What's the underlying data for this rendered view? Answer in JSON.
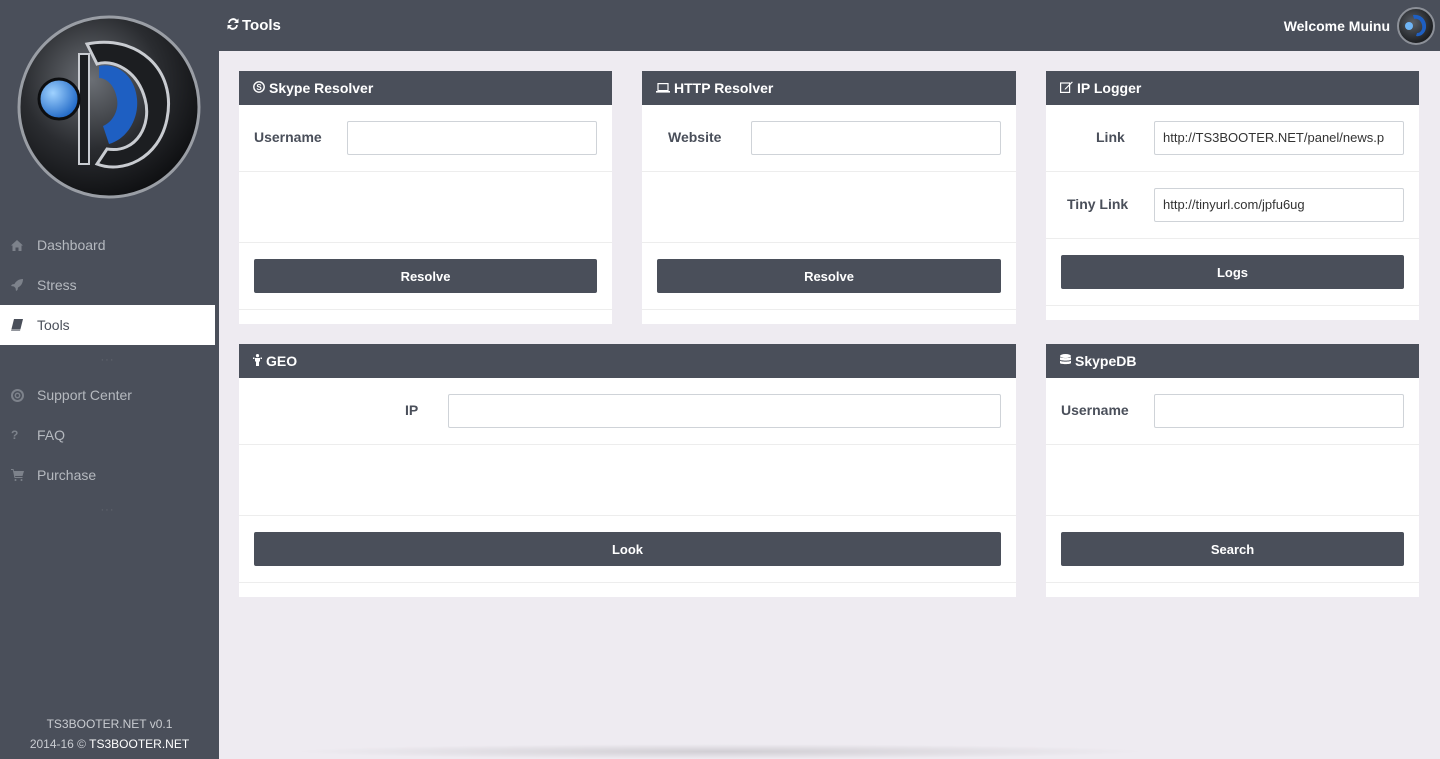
{
  "page_title": "Tools",
  "welcome_text": "Welcome Muinu",
  "sidebar": {
    "items": [
      {
        "label": "Dashboard",
        "icon": "home-icon"
      },
      {
        "label": "Stress",
        "icon": "rocket-icon"
      },
      {
        "label": "Tools",
        "icon": "book-icon",
        "active": true
      },
      {
        "label": "Support Center",
        "icon": "lifebuoy-icon"
      },
      {
        "label": "FAQ",
        "icon": "question-icon"
      },
      {
        "label": "Purchase",
        "icon": "cart-icon"
      }
    ],
    "footer_version": "TS3BOOTER.NET v0.1",
    "footer_copy": "2014-16 ©",
    "footer_brand": "TS3BOOTER.NET"
  },
  "panels": {
    "skype_resolver": {
      "title": "Skype Resolver",
      "username_label": "Username",
      "username_value": "",
      "button": "Resolve"
    },
    "http_resolver": {
      "title": "HTTP Resolver",
      "website_label": "Website",
      "website_value": "",
      "button": "Resolve"
    },
    "ip_logger": {
      "title": "IP Logger",
      "link_label": "Link",
      "link_value": "http://TS3BOOTER.NET/panel/news.p",
      "tiny_label": "Tiny Link",
      "tiny_value": "http://tinyurl.com/jpfu6ug",
      "button": "Logs"
    },
    "geo": {
      "title": "GEO",
      "ip_label": "IP",
      "ip_value": "",
      "button": "Look"
    },
    "skypedb": {
      "title": "SkypeDB",
      "username_label": "Username",
      "username_value": "",
      "button": "Search"
    }
  },
  "colors": {
    "dark": "#4a4f5a",
    "background": "#eeebf1",
    "accent": "#2a6bd6"
  }
}
